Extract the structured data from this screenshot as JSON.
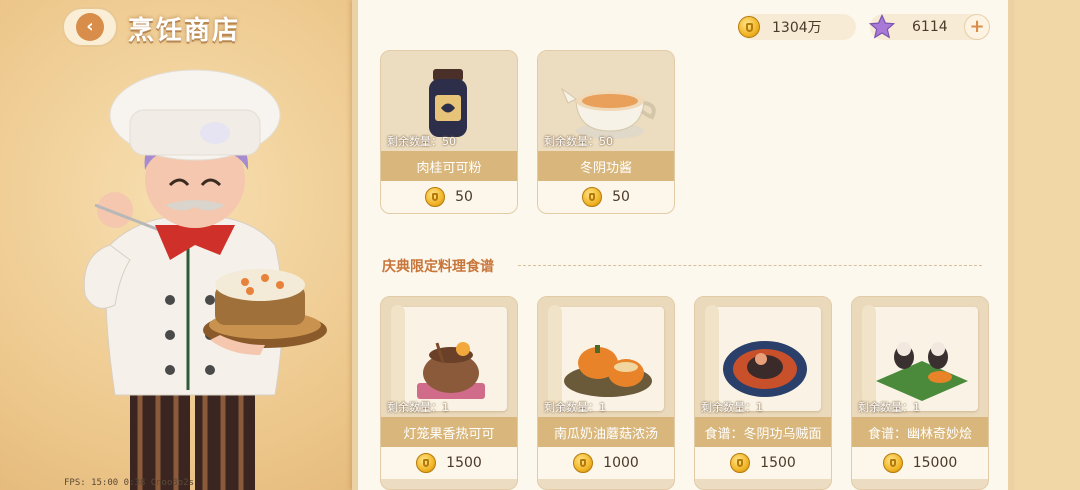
{
  "header": {
    "back_icon": "back-arrow-icon",
    "title": "烹饪商店"
  },
  "currency": {
    "gold": {
      "icon": "gold-coin-icon",
      "value": "1304万"
    },
    "star": {
      "icon": "star-icon",
      "value": "6114",
      "add_icon": "plus-icon",
      "add_label": "+"
    }
  },
  "shop": {
    "items_row1": [
      {
        "name": "肉桂可可粉",
        "remaining": "剩余数量：50",
        "price": "50",
        "icon": "cocoa-jar-icon"
      },
      {
        "name": "冬阴功酱",
        "remaining": "剩余数量：50",
        "price": "50",
        "icon": "sauce-boat-icon"
      }
    ],
    "section_title": "庆典限定料理食谱",
    "items_row2": [
      {
        "name": "灯笼果香热可可",
        "remaining": "剩余数量：1",
        "price": "1500",
        "icon": "hot-cocoa-recipe-icon"
      },
      {
        "name": "南瓜奶油蘑菇浓汤",
        "remaining": "剩余数量：1",
        "price": "1000",
        "icon": "pumpkin-soup-recipe-icon"
      },
      {
        "name": "食谱：冬阴功乌贼面",
        "remaining": "剩余数量：1",
        "price": "1500",
        "icon": "squid-noodle-recipe-icon"
      },
      {
        "name": "食谱：幽林奇妙烩",
        "remaining": "剩余数量：1",
        "price": "15000",
        "icon": "forest-stew-recipe-icon"
      }
    ]
  },
  "debug": "FPS: 15:00  0:38  Cnoo3o2s"
}
